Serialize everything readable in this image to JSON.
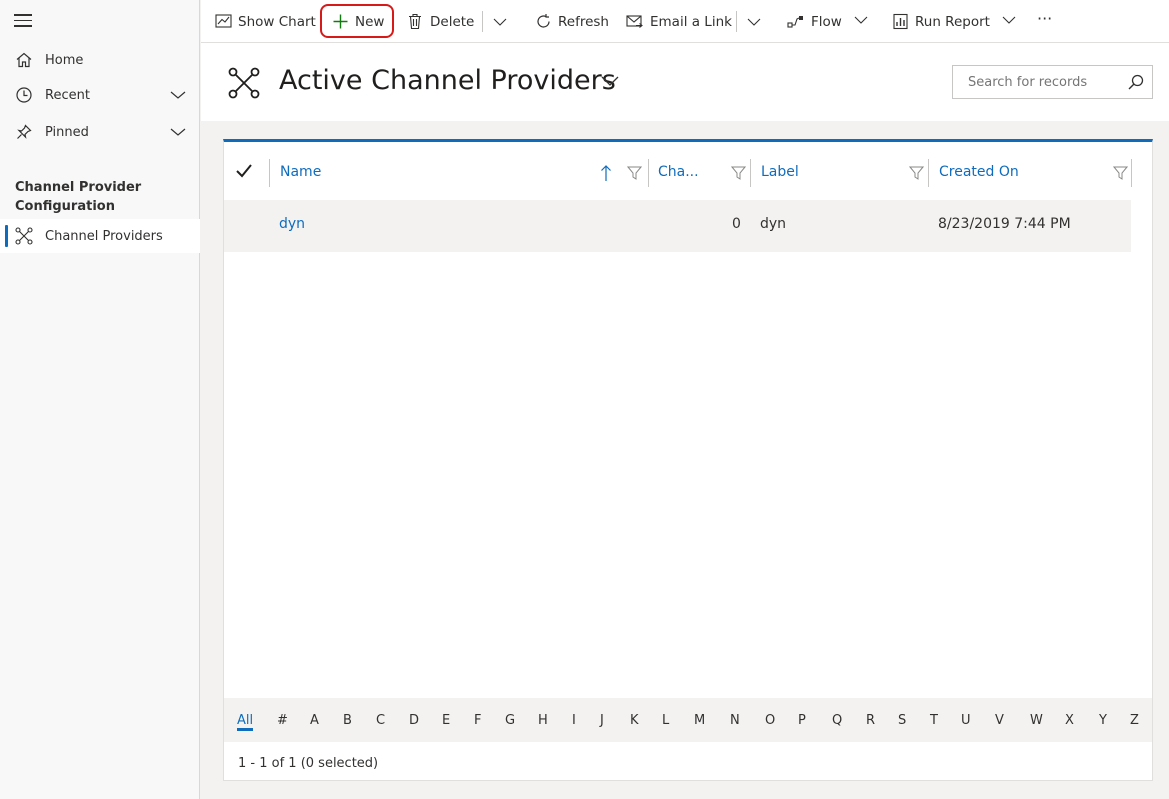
{
  "sidebar": {
    "home": "Home",
    "recent": "Recent",
    "pinned": "Pinned",
    "section_title": "Channel Provider Configuration",
    "channel_providers": "Channel Providers"
  },
  "toolbar": {
    "show_chart": "Show Chart",
    "new": "New",
    "delete": "Delete",
    "refresh": "Refresh",
    "email_link": "Email a Link",
    "flow": "Flow",
    "run_report": "Run Report",
    "more": "···"
  },
  "header": {
    "title": "Active Channel Providers",
    "search_placeholder": "Search for records"
  },
  "grid": {
    "columns": [
      "Name",
      "Cha...",
      "Label",
      "Created On"
    ],
    "rows": [
      {
        "name": "dyn",
        "channel": "0",
        "label": "dyn",
        "created_on": "8/23/2019 7:44 PM"
      }
    ],
    "status": "1 - 1 of 1 (0 selected)"
  },
  "jumpbar": {
    "letters": [
      "All",
      "#",
      "A",
      "B",
      "C",
      "D",
      "E",
      "F",
      "G",
      "H",
      "I",
      "J",
      "K",
      "L",
      "M",
      "N",
      "O",
      "P",
      "Q",
      "R",
      "S",
      "T",
      "U",
      "V",
      "W",
      "X",
      "Y",
      "Z"
    ]
  },
  "colors": {
    "accent": "#0f6cbd",
    "highlight_ring": "#d61a1a",
    "new_plus": "#107c10"
  }
}
